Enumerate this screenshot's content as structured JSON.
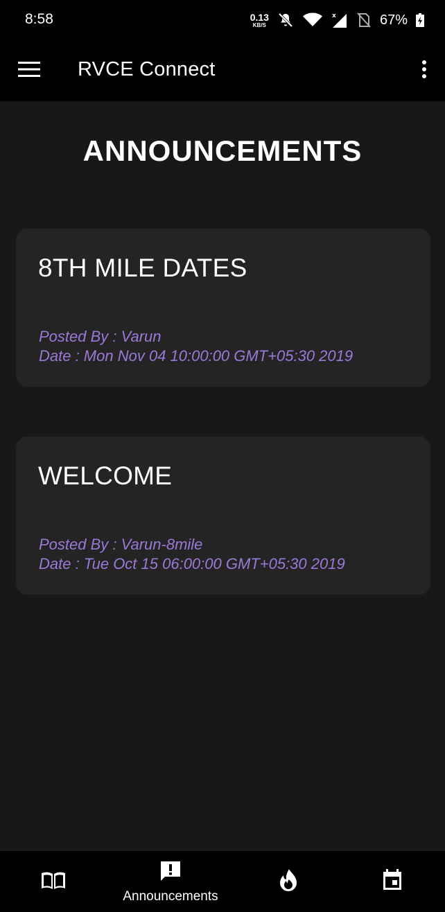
{
  "status_bar": {
    "time": "8:58",
    "net_speed_value": "0.13",
    "net_speed_unit": "KB/S",
    "battery": "67%",
    "icons": [
      "mute-bell-icon",
      "wifi-icon",
      "cell-signal-icon",
      "no-sim-icon",
      "battery-charging-icon"
    ]
  },
  "app_bar": {
    "title": "RVCE Connect",
    "menu_icon": "hamburger-menu-icon",
    "overflow_icon": "more-vert-icon"
  },
  "page": {
    "heading": "ANNOUNCEMENTS"
  },
  "announcements": [
    {
      "title": "8TH MILE DATES",
      "posted_by": "Posted By : Varun",
      "date": "Date : Mon Nov 04 10:00:00 GMT+05:30 2019"
    },
    {
      "title": "WELCOME",
      "posted_by": "Posted By : Varun-8mile",
      "date": "Date : Tue Oct 15 06:00:00 GMT+05:30 2019"
    }
  ],
  "bottom_nav": {
    "items": [
      {
        "icon": "book-icon",
        "label": ""
      },
      {
        "icon": "announcement-icon",
        "label": "Announcements",
        "active": true
      },
      {
        "icon": "flame-icon",
        "label": ""
      },
      {
        "icon": "calendar-icon",
        "label": ""
      }
    ]
  },
  "colors": {
    "background": "#181818",
    "card": "#242424",
    "bar": "#000000",
    "meta_text": "#9b79d8",
    "text": "#ffffff"
  }
}
